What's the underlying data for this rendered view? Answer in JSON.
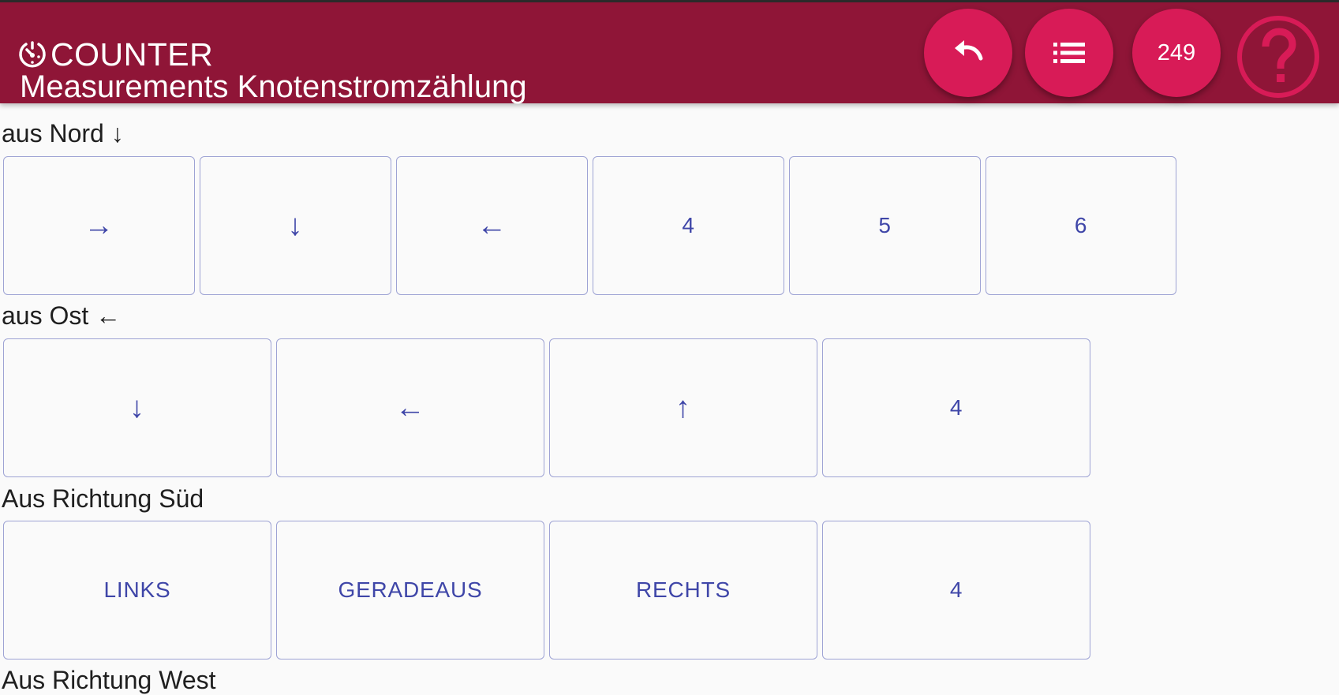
{
  "header": {
    "app_icon": "timer-icon",
    "app_name": "COUNTER",
    "title": "Measurements Knotenstromzählung",
    "undo_icon": "undo-icon",
    "list_icon": "list-icon",
    "count": "249",
    "help_icon": "help-circle-icon",
    "colors": {
      "bar": "#8f1537",
      "fab": "#d81b57",
      "help": "#d81b57"
    }
  },
  "sections": [
    {
      "label": "aus Nord ↓",
      "buttons": [
        "→",
        "↓",
        "←",
        "4",
        "5",
        "6"
      ]
    },
    {
      "label": "aus Ost ←",
      "buttons": [
        "↓",
        "←",
        "↑",
        "4"
      ]
    },
    {
      "label": "Aus Richtung Süd",
      "buttons": [
        "LINKS",
        "GERADEAUS",
        "RECHTS",
        "4"
      ]
    },
    {
      "label": "Aus Richtung West"
    }
  ],
  "button_colors": {
    "border": "#9ea3d4",
    "text": "#3f46a8"
  }
}
